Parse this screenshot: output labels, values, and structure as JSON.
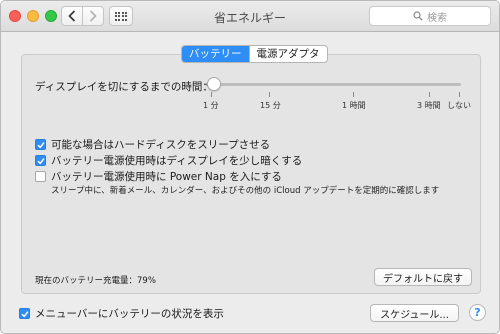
{
  "window": {
    "title": "省エネルギー",
    "search_placeholder": "検索"
  },
  "tabs": [
    {
      "label": "バッテリー",
      "active": true
    },
    {
      "label": "電源アダプタ",
      "active": false
    }
  ],
  "display_sleep": {
    "label": "ディスプレイを切にするまでの時間：",
    "value_fraction": 0.03,
    "ticks": [
      "1 分",
      "15 分",
      "1 時間",
      "3 時間",
      "しない"
    ]
  },
  "options": [
    {
      "label": "可能な場合はハードディスクをスリープさせる",
      "checked": true
    },
    {
      "label": "バッテリー電源使用時はディスプレイを少し暗くする",
      "checked": true
    },
    {
      "label": "バッテリー電源使用時に Power Nap を入にする",
      "checked": false
    }
  ],
  "power_nap_description": "スリープ中に、新着メール、カレンダー、およびその他の iCloud アップデートを定期的に確認します",
  "battery_charge": "現在のバッテリー充電量：79%",
  "buttons": {
    "restore_defaults": "デフォルトに戻す",
    "schedule": "スケジュール...",
    "help": "?"
  },
  "menubar_option": {
    "label": "メニューバーにバッテリーの状況を表示",
    "checked": true
  },
  "colors": {
    "accent": "#2f8ef5"
  }
}
